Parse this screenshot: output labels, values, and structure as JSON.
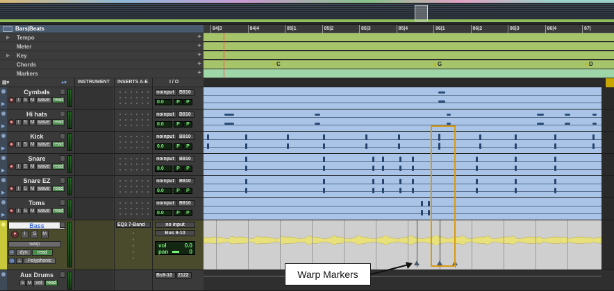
{
  "ruler": {
    "rows": [
      {
        "key": "bars",
        "label": "Bars|Beats"
      },
      {
        "key": "tempo",
        "label": "Tempo"
      },
      {
        "key": "meter",
        "label": "Meter"
      },
      {
        "key": "key",
        "label": "Key"
      },
      {
        "key": "chords",
        "label": "Chords"
      },
      {
        "key": "markers",
        "label": "Markers"
      }
    ],
    "bar_ticks": [
      "84|3",
      "84|4",
      "85|1",
      "85|2",
      "85|3",
      "85|4",
      "86|1",
      "86|2",
      "86|3",
      "86|4",
      "87|"
    ],
    "chords": [
      "C",
      "G",
      "D"
    ]
  },
  "columns": {
    "instrument": "INSTRUMENT",
    "inserts": "INSERTS A-E",
    "io": "I / O"
  },
  "tracks": [
    {
      "name": "Cymbals",
      "input": "noinput",
      "output": "B910",
      "vol": "0.0",
      "mode": "wave",
      "auto": "read"
    },
    {
      "name": "Hi hats",
      "input": "noinput",
      "output": "B910",
      "vol": "0.0",
      "mode": "wave",
      "auto": "read"
    },
    {
      "name": "Kick",
      "input": "noinput",
      "output": "B910",
      "vol": "0.0",
      "mode": "wave",
      "auto": "read"
    },
    {
      "name": "Snare",
      "input": "noinput",
      "output": "B910",
      "vol": "0.0",
      "mode": "wave",
      "auto": "read"
    },
    {
      "name": "Snare EZ",
      "input": "noinput",
      "output": "B910",
      "vol": "0.0",
      "mode": "wave",
      "auto": "read"
    },
    {
      "name": "Toms",
      "input": "noinput",
      "output": "B910",
      "vol": "0.0",
      "mode": "wave",
      "auto": "read"
    }
  ],
  "buttons": {
    "i": "I",
    "s": "S",
    "m": "M",
    "p": "P"
  },
  "bass": {
    "name": "Bass",
    "insert": "EQ3 7-Band",
    "input": "no input",
    "output": "Bus 9-10",
    "mode": "warp",
    "dyn": "dyn",
    "auto": "read",
    "vol_label": "vol",
    "vol": "0.0",
    "pan_label": "pan",
    "pan": "0",
    "plugin": "Polyphonic"
  },
  "aux": {
    "name": "Aux Drums",
    "input": "Bs9-10",
    "output": "2122",
    "vol_label": "vol",
    "auto": "read"
  },
  "annotation": {
    "callout": "Warp Markers",
    "box_color": "#d99a10"
  },
  "colors": {
    "track_audio": "#a9c4e6",
    "waveform_bass": "#e8e07a",
    "playhead": "#ff4a4a",
    "tempo_lane": "#a6c56b",
    "markers_lane": "#9fd6a8"
  }
}
